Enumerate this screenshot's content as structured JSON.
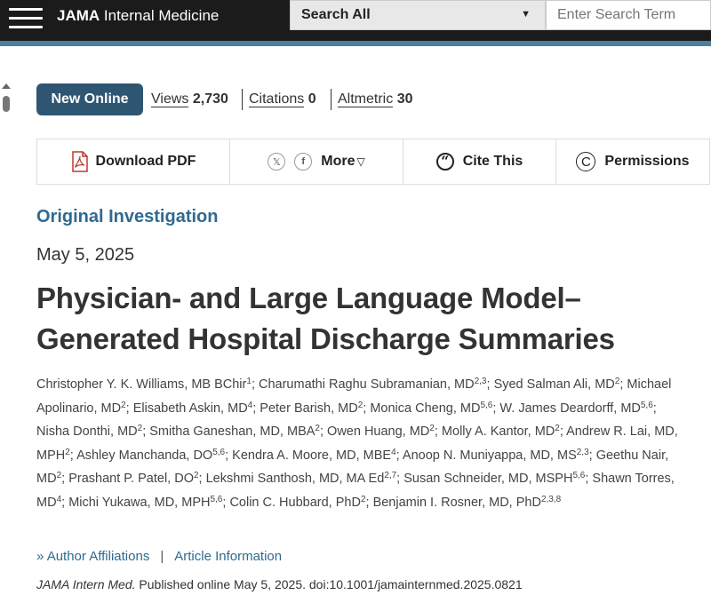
{
  "header": {
    "journal_bold": "JAMA",
    "journal_rest": " Internal Medicine",
    "search_scope": "Search All",
    "search_placeholder": "Enter Search Term"
  },
  "status": {
    "badge": "New Online",
    "views_label": "Views",
    "views_value": "2,730",
    "citations_label": "Citations",
    "citations_value": "0",
    "altmetric_label": "Altmetric",
    "altmetric_value": "30"
  },
  "toolbar": {
    "download": "Download PDF",
    "x_icon_glyph": "𝕏",
    "facebook_icon_glyph": "f",
    "more": "More",
    "cite": "Cite This",
    "permissions": "Permissions"
  },
  "article": {
    "category": "Original Investigation",
    "date": "May 5, 2025",
    "title": "Physician- and Large Language Model–Generated Hospital Discharge Summaries"
  },
  "authors": [
    {
      "name": "Christopher Y. K. Williams, MB BChir",
      "aff": "1"
    },
    {
      "name": "Charumathi Raghu Subramanian, MD",
      "aff": "2,3"
    },
    {
      "name": "Syed Salman Ali, MD",
      "aff": "2"
    },
    {
      "name": "Michael Apolinario, MD",
      "aff": "2"
    },
    {
      "name": "Elisabeth Askin, MD",
      "aff": "4"
    },
    {
      "name": "Peter Barish, MD",
      "aff": "2"
    },
    {
      "name": "Monica Cheng, MD",
      "aff": "5,6"
    },
    {
      "name": "W. James Deardorff, MD",
      "aff": "5,6"
    },
    {
      "name": "Nisha Donthi, MD",
      "aff": "2"
    },
    {
      "name": "Smitha Ganeshan, MD, MBA",
      "aff": "2"
    },
    {
      "name": "Owen Huang, MD",
      "aff": "2"
    },
    {
      "name": "Molly A. Kantor, MD",
      "aff": "2"
    },
    {
      "name": "Andrew R. Lai, MD, MPH",
      "aff": "2"
    },
    {
      "name": "Ashley Manchanda, DO",
      "aff": "5,6"
    },
    {
      "name": "Kendra A. Moore, MD, MBE",
      "aff": "4"
    },
    {
      "name": "Anoop N. Muniyappa, MD, MS",
      "aff": "2,3"
    },
    {
      "name": "Geethu Nair, MD",
      "aff": "2"
    },
    {
      "name": "Prashant P. Patel, DO",
      "aff": "2"
    },
    {
      "name": "Lekshmi Santhosh, MD, MA Ed",
      "aff": "2,7"
    },
    {
      "name": "Susan Schneider, MD, MSPH",
      "aff": "5,6"
    },
    {
      "name": "Shawn Torres, MD",
      "aff": "4"
    },
    {
      "name": "Michi Yukawa, MD, MPH",
      "aff": "5,6"
    },
    {
      "name": "Colin C. Hubbard, PhD",
      "aff": "2"
    },
    {
      "name": "Benjamin I. Rosner, MD, PhD",
      "aff": "2,3,8"
    }
  ],
  "links": {
    "affiliations": "Author Affiliations",
    "separator": "|",
    "article_info": "Article Information"
  },
  "citation": {
    "journal": "JAMA Intern Med.",
    "text": " Published online May 5, 2025. doi:10.1001/jamainternmed.2025.0821"
  }
}
